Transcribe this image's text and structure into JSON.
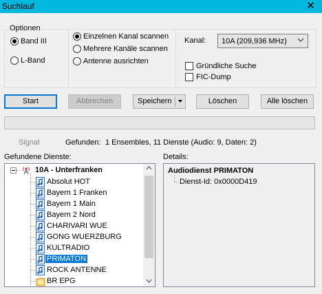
{
  "window": {
    "title": "Suchlauf",
    "close_glyph": "✕"
  },
  "options": {
    "legend": "Optionen",
    "band3": "Band III",
    "lband": "L-Band",
    "band_selected": "Band III",
    "scan_single": "Einzelnen Kanal scannen",
    "scan_multi": "Mehrere Kanäle scannen",
    "scan_antenna": "Antenne ausrichten",
    "scan_selected": "Einzelnen Kanal scannen",
    "channel_label": "Kanal:",
    "channel_value": "10A (209,936 MHz)",
    "thorough": "Gründliche Suche",
    "fic_dump": "FIC-Dump"
  },
  "buttons": {
    "start": "Start",
    "cancel": "Abbrechen",
    "save": "Speichern",
    "delete": "Löschen",
    "delete_all": "Alle löschen"
  },
  "status": {
    "signal": "Signal",
    "found_label": "Gefunden:",
    "found_value": "1 Ensembles, 11 Dienste (Audio: 9, Daten: 2)"
  },
  "services": {
    "label": "Gefundene Dienste:",
    "ensemble": "10A - Unterfranken",
    "items": [
      {
        "name": "Absolut HOT",
        "icon": "audio-note-icon"
      },
      {
        "name": "Bayern 1 Franken",
        "icon": "audio-note-icon"
      },
      {
        "name": "Bayern 1 Main",
        "icon": "audio-note-icon"
      },
      {
        "name": "Bayern 2 Nord",
        "icon": "audio-note-icon"
      },
      {
        "name": "CHARIVARI WUE",
        "icon": "audio-note-icon"
      },
      {
        "name": "GONG WUERZBURG",
        "icon": "audio-note-icon"
      },
      {
        "name": "KULTRADIO",
        "icon": "audio-note-icon"
      },
      {
        "name": "PRIMATON",
        "icon": "audio-note-icon",
        "selected": true
      },
      {
        "name": "ROCK ANTENNE",
        "icon": "audio-note-icon"
      },
      {
        "name": "BR EPG",
        "icon": "data-folder-icon"
      }
    ]
  },
  "details": {
    "label": "Details:",
    "heading": "Audiodienst PRIMATON",
    "service_id": "Dienst-Id: 0x0000D419"
  },
  "colors": {
    "titlebar": "#00b7dd",
    "selection": "#0078d7"
  }
}
